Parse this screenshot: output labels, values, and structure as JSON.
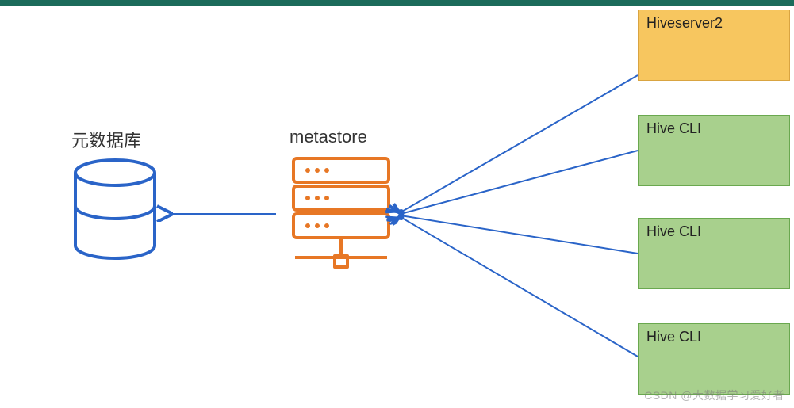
{
  "diagram": {
    "db_label": "元数据库",
    "metastore_label": "metastore",
    "clients": {
      "hs2": "Hiveserver2",
      "cli1": "Hive CLI",
      "cli2": "Hive CLI",
      "cli3": "Hive CLI"
    },
    "watermark": "CSDN @大数据学习爱好者",
    "colors": {
      "topbar": "#1b6b5a",
      "db_stroke": "#2a64c8",
      "server_stroke": "#e77725",
      "arrow": "#2a64c8",
      "hs2_fill": "#f7c65f",
      "hs2_border": "#d9a441",
      "cli_fill": "#a8d08d",
      "cli_border": "#6aa84f"
    }
  }
}
